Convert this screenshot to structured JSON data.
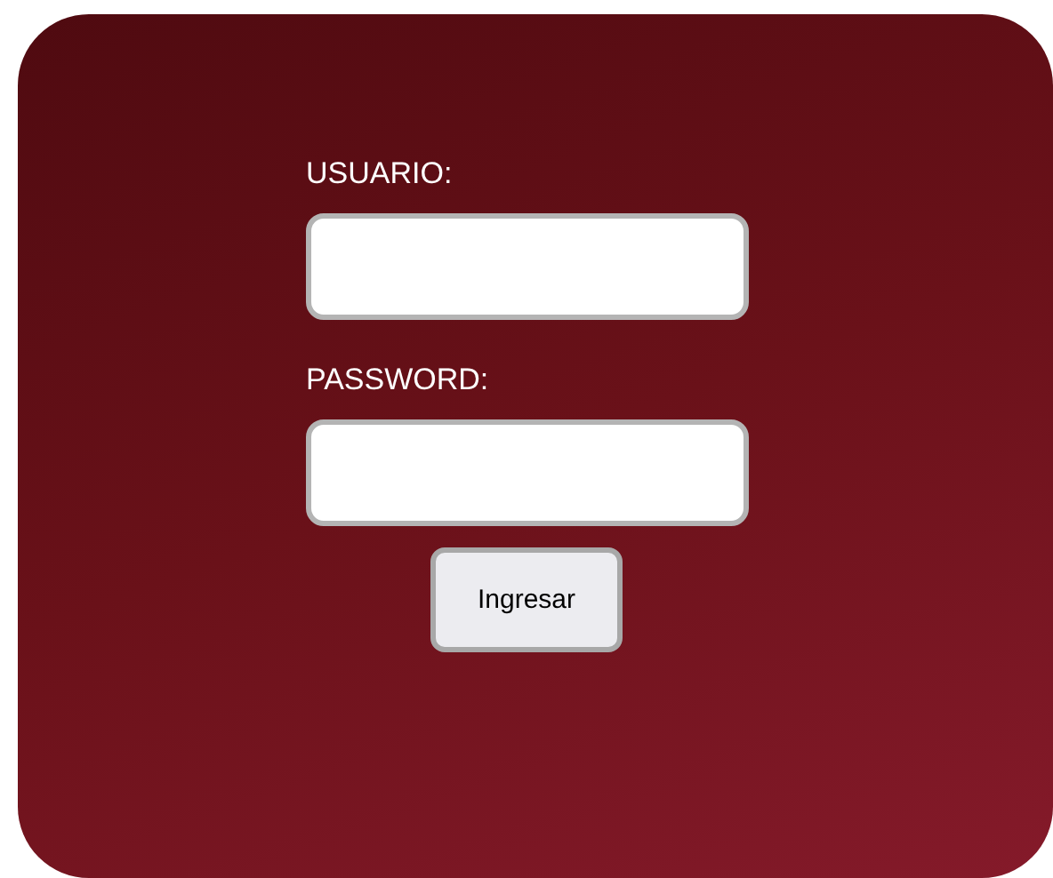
{
  "form": {
    "fields": [
      {
        "label": "USUARIO:"
      },
      {
        "label": "PASSWORD:"
      }
    ],
    "submit": "Ingresar"
  }
}
